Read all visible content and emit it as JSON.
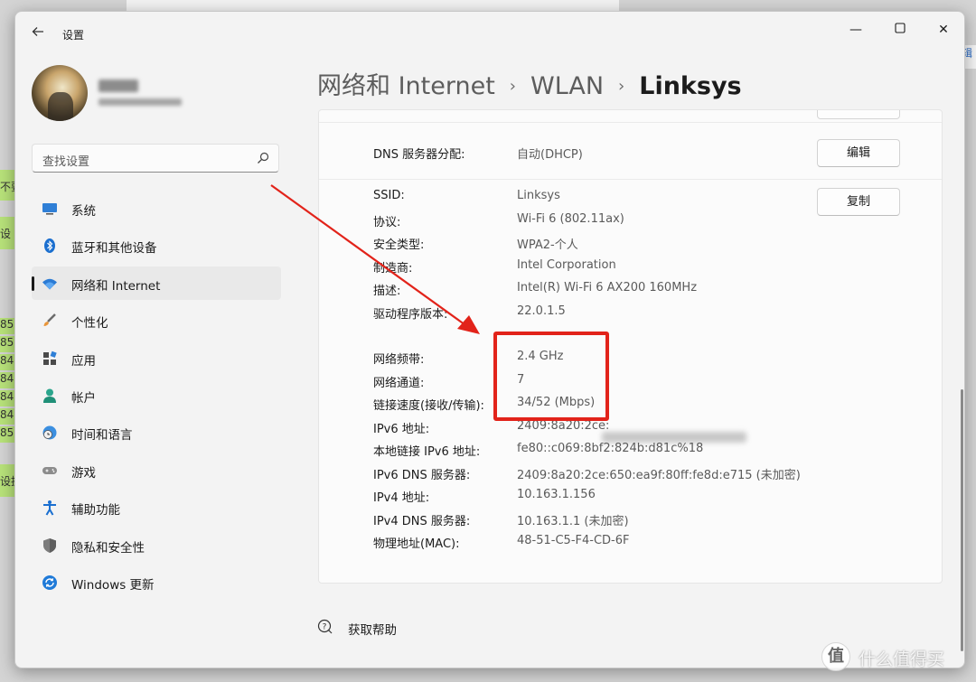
{
  "background": {
    "green_snippets": [
      "不要",
      "设",
      "85",
      "85",
      "84",
      "84",
      "84",
      "84",
      "85",
      "设据"
    ],
    "right_snippet": "辑"
  },
  "window": {
    "title": "设置",
    "back_icon": "arrow-left-icon",
    "controls": {
      "minimize": "—",
      "maximize": "☐",
      "close": "✕"
    }
  },
  "search": {
    "placeholder": "查找设置",
    "icon": "search-icon"
  },
  "nav": {
    "items": [
      {
        "label": "系统",
        "icon": "system-monitor-icon",
        "active": false
      },
      {
        "label": "蓝牙和其他设备",
        "icon": "bluetooth-icon",
        "active": false
      },
      {
        "label": "网络和 Internet",
        "icon": "wifi-icon",
        "active": true
      },
      {
        "label": "个性化",
        "icon": "brush-icon",
        "active": false
      },
      {
        "label": "应用",
        "icon": "apps-icon",
        "active": false
      },
      {
        "label": "帐户",
        "icon": "account-icon",
        "active": false
      },
      {
        "label": "时间和语言",
        "icon": "globe-clock-icon",
        "active": false
      },
      {
        "label": "游戏",
        "icon": "gamepad-icon",
        "active": false
      },
      {
        "label": "辅助功能",
        "icon": "accessibility-icon",
        "active": false
      },
      {
        "label": "隐私和安全性",
        "icon": "shield-icon",
        "active": false
      },
      {
        "label": "Windows 更新",
        "icon": "windows-update-icon",
        "active": false
      }
    ]
  },
  "breadcrumb": {
    "parts": [
      "网络和 Internet",
      "WLAN"
    ],
    "current": "Linksys",
    "separator": "›"
  },
  "properties": {
    "dns_assignment": {
      "label": "DNS 服务器分配:",
      "value": "自动(DHCP)",
      "button": "编辑"
    },
    "copy_button": "复制",
    "rows": [
      {
        "label": "SSID:",
        "value": "Linksys"
      },
      {
        "label": "协议:",
        "value": "Wi-Fi 6 (802.11ax)"
      },
      {
        "label": "安全类型:",
        "value": "WPA2-个人"
      },
      {
        "label": "制造商:",
        "value": "Intel Corporation"
      },
      {
        "label": "描述:",
        "value": "Intel(R) Wi-Fi 6 AX200 160MHz"
      },
      {
        "label": "驱动程序版本:",
        "value": "22.0.1.5"
      },
      {
        "label": "网络频带:",
        "value": "2.4 GHz"
      },
      {
        "label": "网络通道:",
        "value": "7"
      },
      {
        "label": "链接速度(接收/传输):",
        "value": "34/52 (Mbps)"
      },
      {
        "label": "IPv6 地址:",
        "value": "2409:8a20:2ce:"
      },
      {
        "label": "本地链接 IPv6 地址:",
        "value": "fe80::c069:8bf2:824b:d81c%18"
      },
      {
        "label": "IPv6 DNS 服务器:",
        "value": "2409:8a20:2ce:650:ea9f:80ff:fe8d:e715 (未加密)"
      },
      {
        "label": "IPv4 地址:",
        "value": "10.163.1.156"
      },
      {
        "label": "IPv4 DNS 服务器:",
        "value": "10.163.1.1 (未加密)"
      },
      {
        "label": "物理地址(MAC):",
        "value": "48-51-C5-F4-CD-6F"
      }
    ]
  },
  "help": {
    "label": "获取帮助",
    "icon": "help-icon"
  },
  "annotation": {
    "color": "#e2231a"
  },
  "watermark": {
    "logo": "值",
    "text": "什么值得买"
  },
  "colors": {
    "accent": "#0067c0",
    "highlight": "#e2231a"
  }
}
